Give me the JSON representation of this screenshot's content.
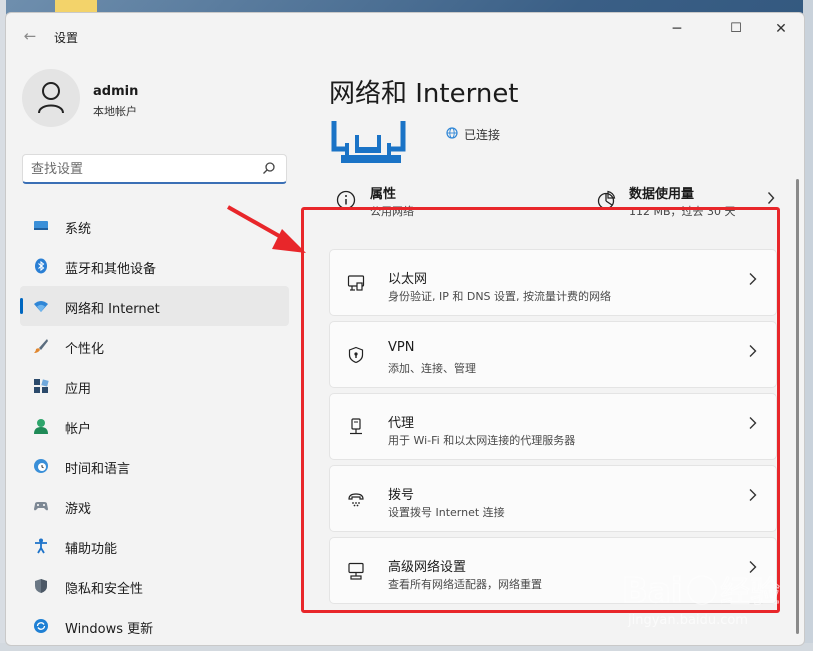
{
  "window": {
    "title": "设置",
    "back_glyph": "←",
    "controls": {
      "minimize": "─",
      "maximize": "☐",
      "close": "✕"
    }
  },
  "user": {
    "name": "admin",
    "account_type": "本地帐户"
  },
  "search": {
    "placeholder": "查找设置"
  },
  "sidebar": {
    "items": [
      {
        "label": "系统",
        "icon": "monitor-icon",
        "active": false
      },
      {
        "label": "蓝牙和其他设备",
        "icon": "bluetooth-icon",
        "active": false
      },
      {
        "label": "网络和 Internet",
        "icon": "wifi-icon",
        "active": true
      },
      {
        "label": "个性化",
        "icon": "brush-icon",
        "active": false
      },
      {
        "label": "应用",
        "icon": "apps-icon",
        "active": false
      },
      {
        "label": "帐户",
        "icon": "person-icon",
        "active": false
      },
      {
        "label": "时间和语言",
        "icon": "globe-clock-icon",
        "active": false
      },
      {
        "label": "游戏",
        "icon": "gamepad-icon",
        "active": false
      },
      {
        "label": "辅助功能",
        "icon": "accessibility-icon",
        "active": false
      },
      {
        "label": "隐私和安全性",
        "icon": "shield-icon",
        "active": false
      },
      {
        "label": "Windows 更新",
        "icon": "update-icon",
        "active": false
      }
    ]
  },
  "main": {
    "title": "网络和 Internet",
    "status": "已连接",
    "properties": {
      "title": "属性",
      "subtitle": "公用网络"
    },
    "data_usage": {
      "title": "数据使用量",
      "subtitle": "112 MB，过去 30 天"
    },
    "cards": [
      {
        "title": "以太网",
        "subtitle": "身份验证, IP 和 DNS 设置, 按流量计费的网络",
        "icon": "ethernet-icon"
      },
      {
        "title": "VPN",
        "subtitle": "添加、连接、管理",
        "icon": "vpn-shield-icon"
      },
      {
        "title": "代理",
        "subtitle": "用于 Wi-Fi 和以太网连接的代理服务器",
        "icon": "proxy-icon"
      },
      {
        "title": "拨号",
        "subtitle": "设置拨号 Internet 连接",
        "icon": "dialup-icon"
      },
      {
        "title": "高级网络设置",
        "subtitle": "查看所有网络适配器，网络重置",
        "icon": "advanced-network-icon"
      }
    ]
  },
  "colors": {
    "accent": "#0067c0",
    "annotation": "#e8262a"
  },
  "watermark": {
    "brand": "Bai经验",
    "url": "jingyan.baidu.com"
  }
}
